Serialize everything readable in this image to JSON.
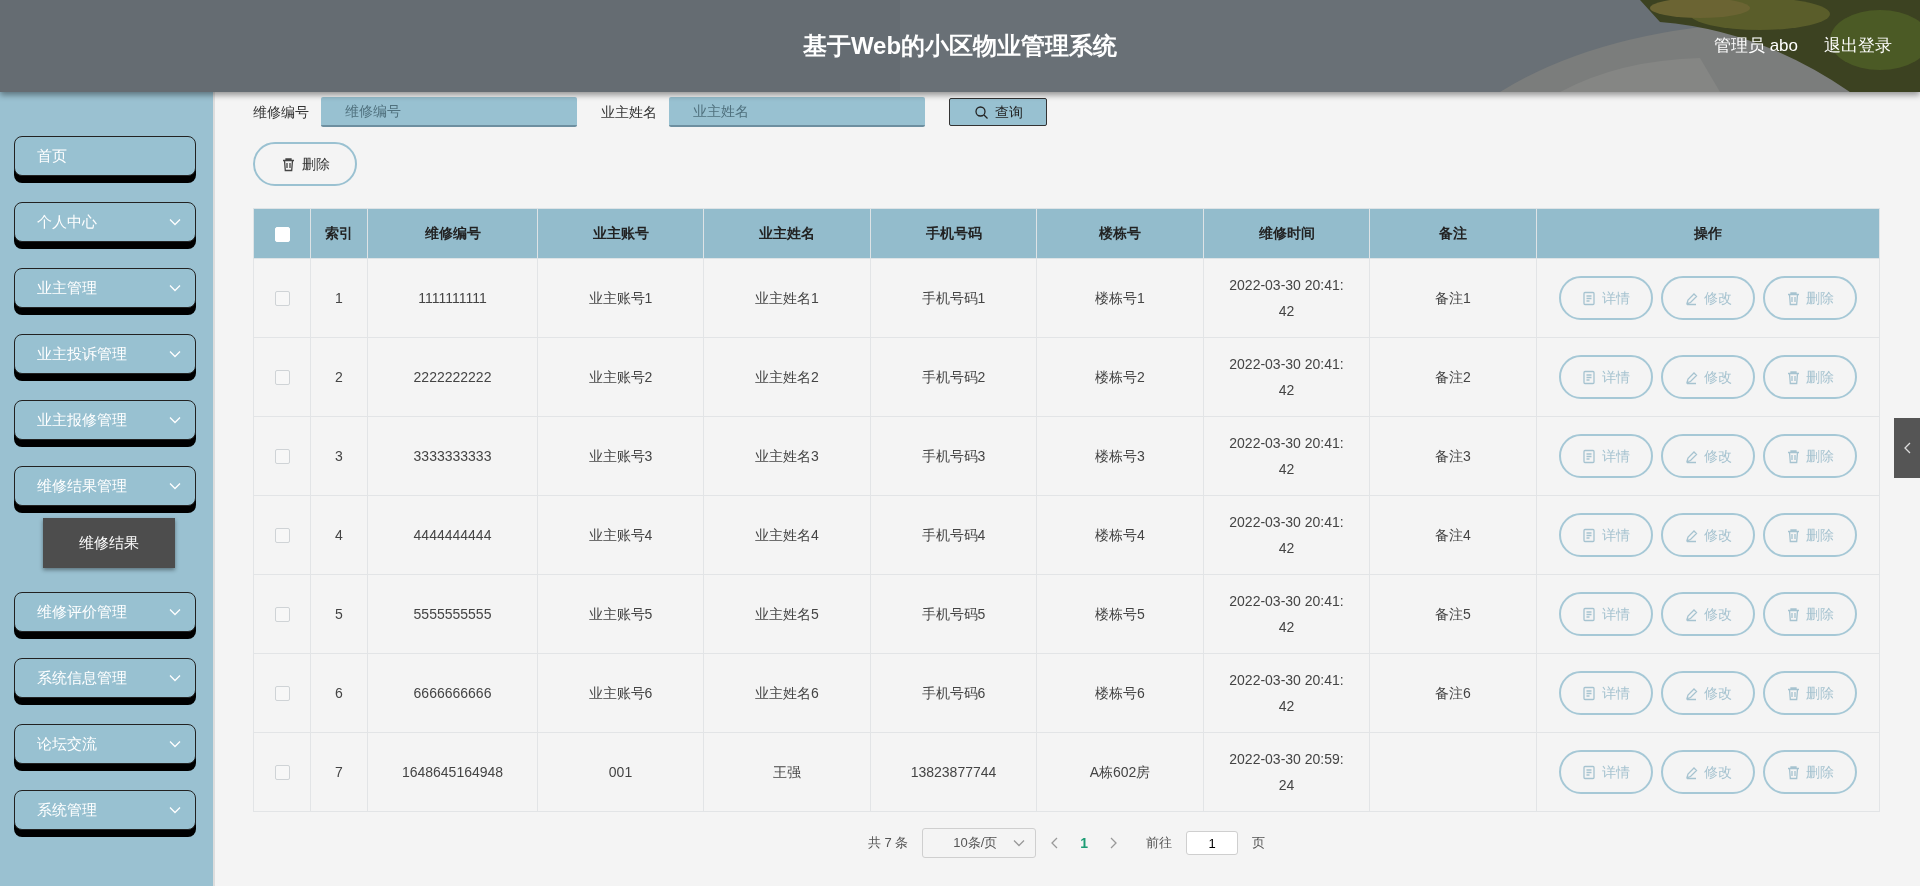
{
  "header": {
    "title": "基于Web的小区物业管理系统",
    "user": "管理员 abo",
    "logout": "退出登录"
  },
  "sidebar": {
    "items": [
      {
        "label": "首页",
        "kind": "link"
      },
      {
        "label": "个人中心",
        "kind": "menu"
      },
      {
        "label": "业主管理",
        "kind": "menu"
      },
      {
        "label": "业主投诉管理",
        "kind": "menu"
      },
      {
        "label": "业主报修管理",
        "kind": "menu"
      },
      {
        "label": "维修结果管理",
        "kind": "menu",
        "children": [
          {
            "label": "维修结果"
          }
        ]
      },
      {
        "label": "维修评价管理",
        "kind": "menu"
      },
      {
        "label": "系统信息管理",
        "kind": "menu"
      },
      {
        "label": "论坛交流",
        "kind": "menu"
      },
      {
        "label": "系统管理",
        "kind": "menu"
      }
    ]
  },
  "search": {
    "fields": [
      {
        "label": "维修编号",
        "placeholder": "维修编号"
      },
      {
        "label": "业主姓名",
        "placeholder": "业主姓名"
      }
    ],
    "button": "查询"
  },
  "toolbar": {
    "delete": "删除"
  },
  "table": {
    "select_all": {
      "checked": false
    },
    "columns": [
      "索引",
      "维修编号",
      "业主账号",
      "业主姓名",
      "手机号码",
      "楼栋号",
      "维修时间",
      "备注",
      "操作"
    ],
    "rows": [
      {
        "checked": false,
        "cells": [
          "1",
          "1111111111",
          "业主账号1",
          "业主姓名1",
          "手机号码1",
          "楼栋号1",
          "2022-03-30 20:41:42",
          "备注1"
        ],
        "actions": [
          "详情",
          "修改",
          "删除"
        ]
      },
      {
        "checked": false,
        "cells": [
          "2",
          "2222222222",
          "业主账号2",
          "业主姓名2",
          "手机号码2",
          "楼栋号2",
          "2022-03-30 20:41:42",
          "备注2"
        ],
        "actions": [
          "详情",
          "修改",
          "删除"
        ]
      },
      {
        "checked": false,
        "cells": [
          "3",
          "3333333333",
          "业主账号3",
          "业主姓名3",
          "手机号码3",
          "楼栋号3",
          "2022-03-30 20:41:42",
          "备注3"
        ],
        "actions": [
          "详情",
          "修改",
          "删除"
        ]
      },
      {
        "checked": false,
        "cells": [
          "4",
          "4444444444",
          "业主账号4",
          "业主姓名4",
          "手机号码4",
          "楼栋号4",
          "2022-03-30 20:41:42",
          "备注4"
        ],
        "actions": [
          "详情",
          "修改",
          "删除"
        ]
      },
      {
        "checked": false,
        "cells": [
          "5",
          "5555555555",
          "业主账号5",
          "业主姓名5",
          "手机号码5",
          "楼栋号5",
          "2022-03-30 20:41:42",
          "备注5"
        ],
        "actions": [
          "详情",
          "修改",
          "删除"
        ]
      },
      {
        "checked": false,
        "cells": [
          "6",
          "6666666666",
          "业主账号6",
          "业主姓名6",
          "手机号码6",
          "楼栋号6",
          "2022-03-30 20:41:42",
          "备注6"
        ],
        "actions": [
          "详情",
          "修改",
          "删除"
        ]
      },
      {
        "checked": false,
        "cells": [
          "7",
          "1648645164948",
          "001",
          "王强",
          "13823877744",
          "A栋602房",
          "2022-03-30 20:59:24"
        ],
        "actions": [
          "详情",
          "修改",
          "删除"
        ]
      }
    ]
  },
  "pagination": {
    "total": "共 7 条",
    "page_size": "10条/页",
    "pages": [
      {
        "label": "1",
        "selected": true
      }
    ],
    "goto_label": "前往",
    "goto_value": "1",
    "goto_suffix": "页"
  }
}
